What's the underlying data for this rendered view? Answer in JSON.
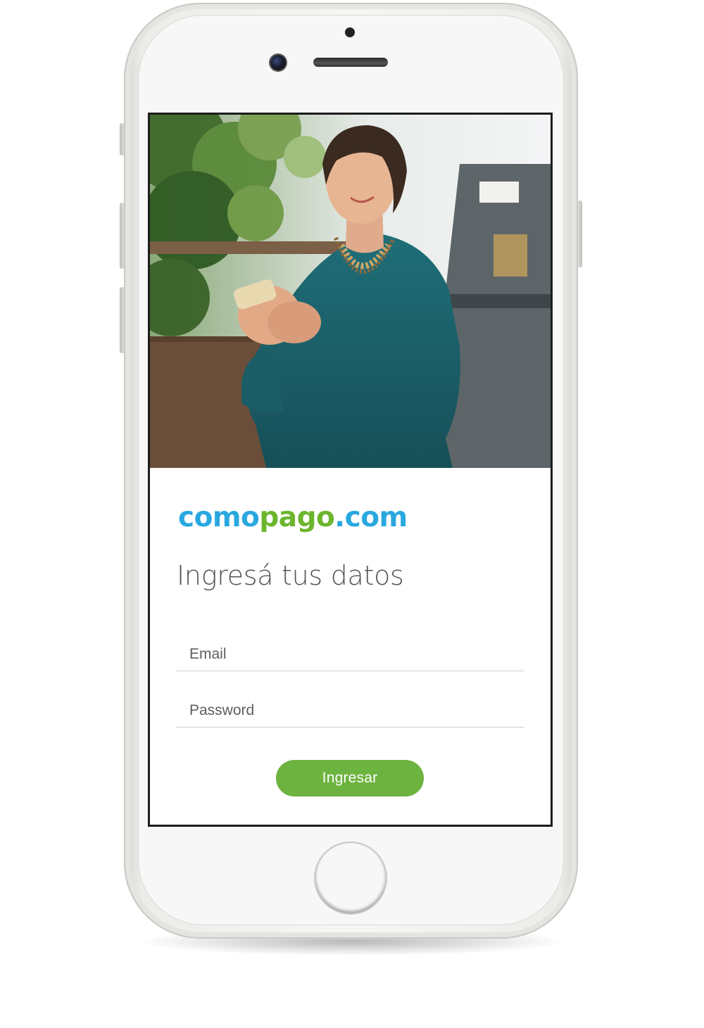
{
  "brand": {
    "logo_part1": "como",
    "logo_part2": "pago",
    "logo_part3": ".com",
    "colors": {
      "blue": "#29a8e0",
      "green": "#6cb52d"
    }
  },
  "login": {
    "title": "Ingresá tus datos",
    "email_placeholder": "Email",
    "password_placeholder": "Password",
    "submit_label": "Ingresar",
    "button_color": "#6db33f"
  },
  "hero": {
    "description_icon": "photo"
  },
  "device": {
    "frame": "white-phone",
    "icons": [
      "front-camera-icon",
      "speaker-icon",
      "home-button-icon"
    ]
  }
}
